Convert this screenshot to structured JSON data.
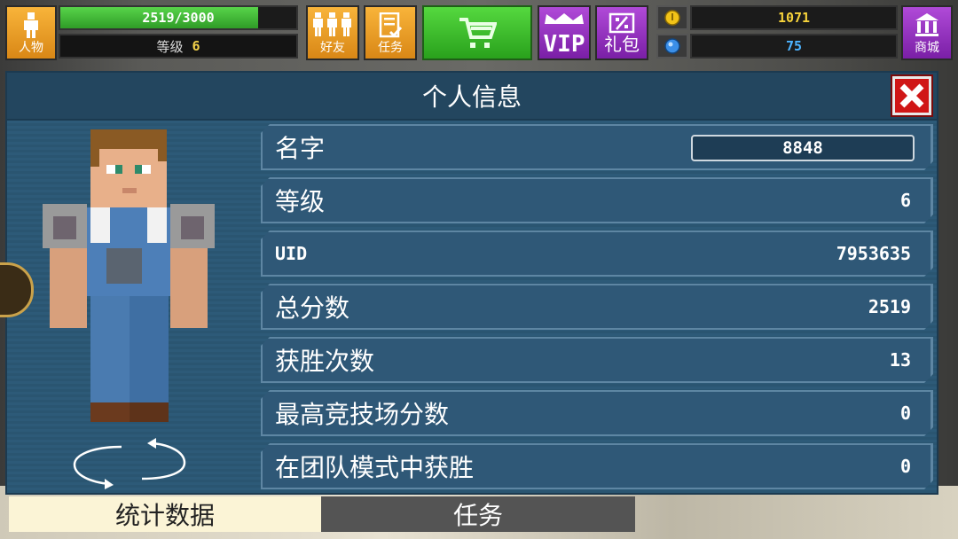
{
  "topbar": {
    "character_label": "人物",
    "hp_value": 2519,
    "hp_max": 3000,
    "hp_text": "2519/3000",
    "level_label": "等级",
    "level_value": "6",
    "friends_label": "好友",
    "tasks_label": "任务",
    "vip_label": "VIP",
    "gift_label": "礼包",
    "coins": "1071",
    "gems": "75",
    "shop_label": "商城"
  },
  "panel": {
    "title": "个人信息",
    "rows": [
      {
        "label": "名字",
        "value": "8848"
      },
      {
        "label": "等级",
        "value": "6"
      },
      {
        "label": "UID",
        "value": "7953635"
      },
      {
        "label": "总分数",
        "value": "2519"
      },
      {
        "label": "获胜次数",
        "value": "13"
      },
      {
        "label": "最高竞技场分数",
        "value": "0"
      },
      {
        "label": "在团队模式中获胜",
        "value": "0"
      }
    ]
  },
  "tabs": {
    "stats": "统计数据",
    "tasks": "任务"
  },
  "colors": {
    "orange": "#f0a22a",
    "purple": "#9a35c4",
    "green": "#3cbf2e",
    "panel": "#2d5a78",
    "close_red": "#d01616"
  }
}
